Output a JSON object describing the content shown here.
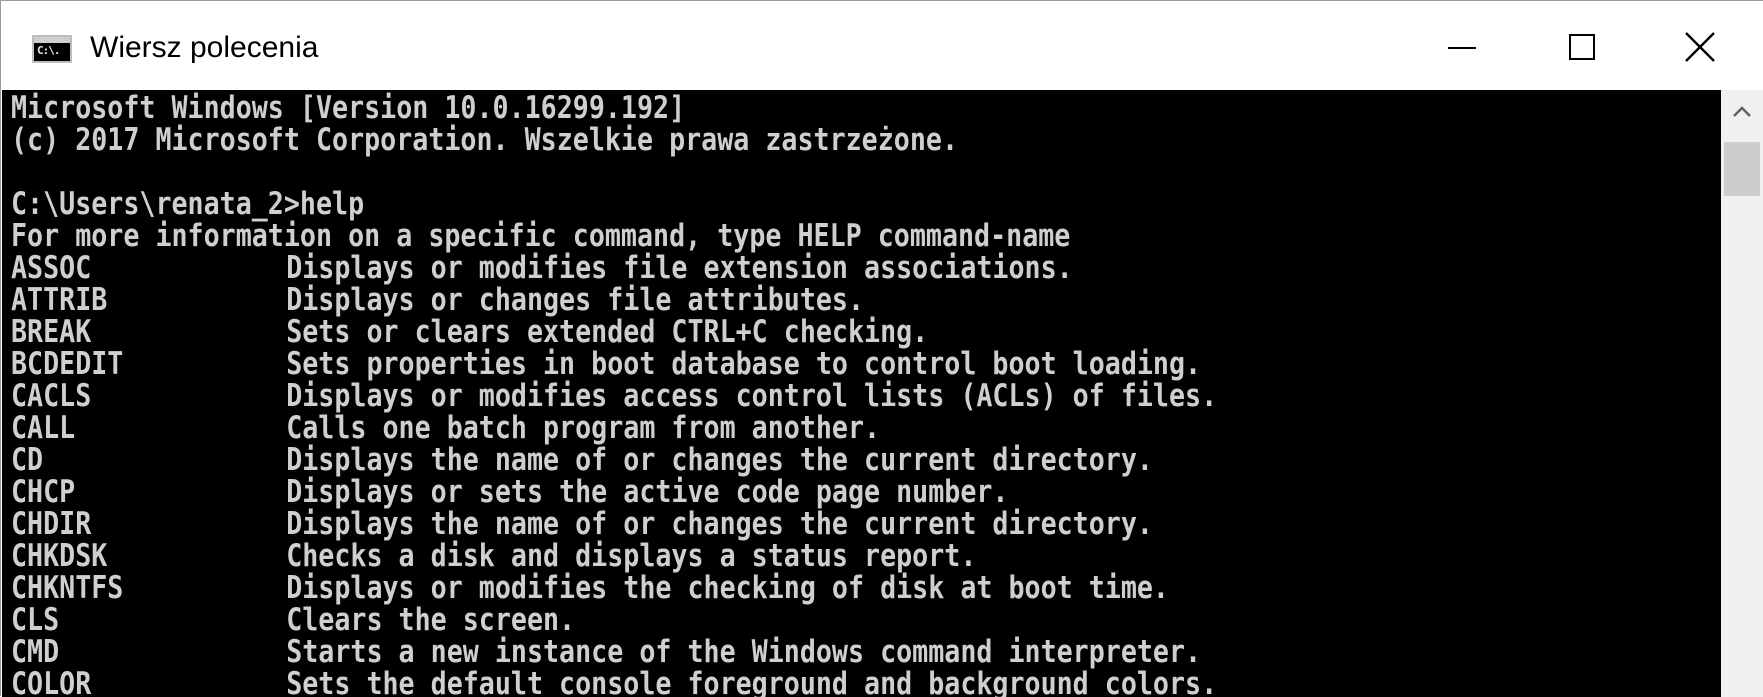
{
  "window": {
    "title": "Wiersz polecenia",
    "icon": "cmd-app-icon",
    "icon_text": "C:\\."
  },
  "controls": {
    "minimize": "minimize-icon",
    "maximize": "maximize-icon",
    "close": "close-icon"
  },
  "console": {
    "header_lines": [
      "Microsoft Windows [Version 10.0.16299.192]",
      "(c) 2017 Microsoft Corporation. Wszelkie prawa zastrzeżone.",
      "",
      "C:\\Users\\renata_2>help",
      "For more information on a specific command, type HELP command-name"
    ],
    "commands": [
      {
        "name": "ASSOC",
        "desc": "Displays or modifies file extension associations."
      },
      {
        "name": "ATTRIB",
        "desc": "Displays or changes file attributes."
      },
      {
        "name": "BREAK",
        "desc": "Sets or clears extended CTRL+C checking."
      },
      {
        "name": "BCDEDIT",
        "desc": "Sets properties in boot database to control boot loading."
      },
      {
        "name": "CACLS",
        "desc": "Displays or modifies access control lists (ACLs) of files."
      },
      {
        "name": "CALL",
        "desc": "Calls one batch program from another."
      },
      {
        "name": "CD",
        "desc": "Displays the name of or changes the current directory."
      },
      {
        "name": "CHCP",
        "desc": "Displays or sets the active code page number."
      },
      {
        "name": "CHDIR",
        "desc": "Displays the name of or changes the current directory."
      },
      {
        "name": "CHKDSK",
        "desc": "Checks a disk and displays a status report."
      },
      {
        "name": "CHKNTFS",
        "desc": "Displays or modifies the checking of disk at boot time."
      },
      {
        "name": "CLS",
        "desc": "Clears the screen."
      },
      {
        "name": "CMD",
        "desc": "Starts a new instance of the Windows command interpreter."
      },
      {
        "name": "COLOR",
        "desc": "Sets the default console foreground and background colors."
      }
    ],
    "colors": {
      "background": "#000000",
      "foreground": "#cfcfcf"
    }
  },
  "scrollbar": {
    "up_arrow": "scroll-up-arrow-icon"
  }
}
